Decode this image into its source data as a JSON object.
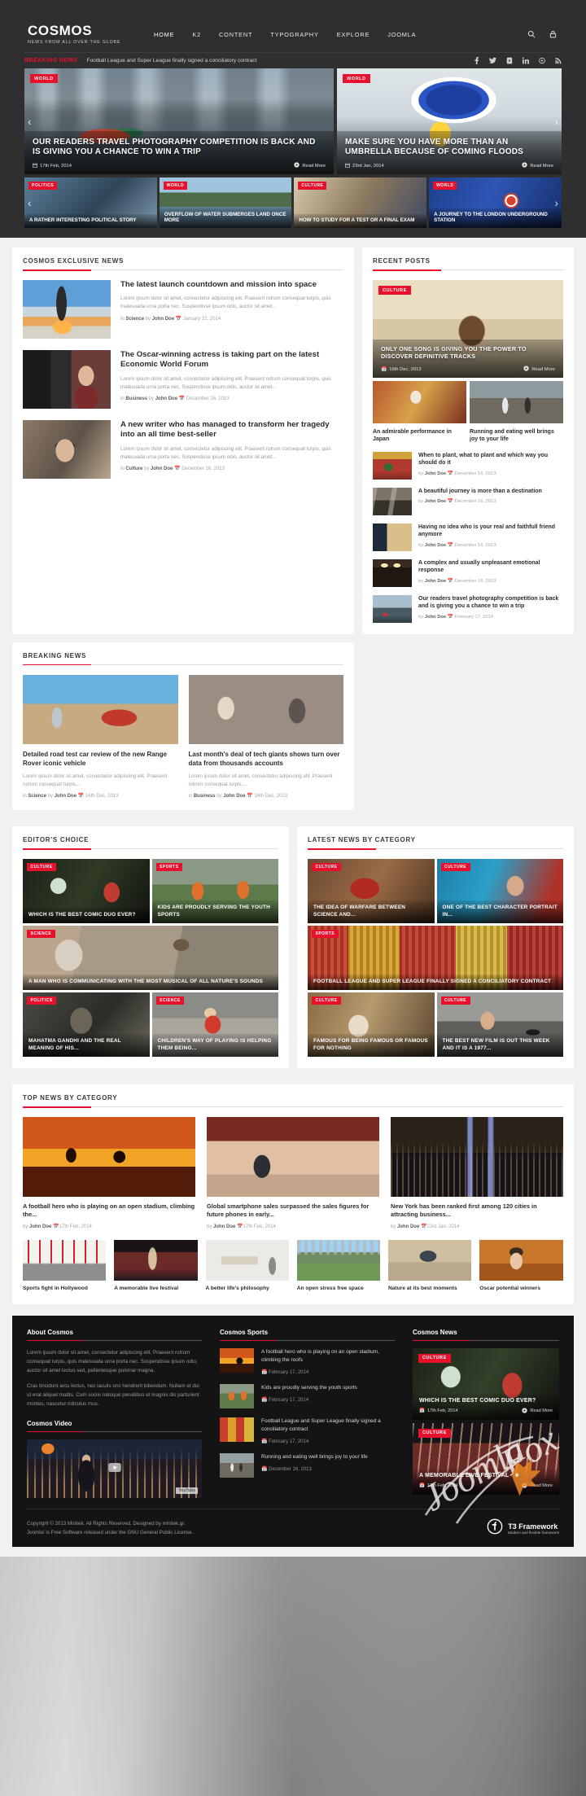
{
  "brand": {
    "name": "COSMOS",
    "tagline": "NEWS FROM ALL OVER THE GLOBE"
  },
  "nav": [
    {
      "label": "HOME"
    },
    {
      "label": "K2"
    },
    {
      "label": "CONTENT"
    },
    {
      "label": "TYPOGRAPHY"
    },
    {
      "label": "EXPLORE"
    },
    {
      "label": "JOOMLA"
    }
  ],
  "header_icons": [
    "search-icon",
    "lock-icon"
  ],
  "breaking_strip": {
    "label": "BREAKING NEWS",
    "text": "Football League and Super League finally signed a conciliatory contract",
    "socials": [
      "facebook-icon",
      "twitter-icon",
      "youtube-icon",
      "linkedin-icon",
      "pinterest-icon",
      "rss-icon"
    ]
  },
  "slider": {
    "prev": "‹",
    "next": "›",
    "slides": [
      {
        "tag": "WORLD",
        "title": "OUR READERS TRAVEL PHOTOGRAPHY COMPETITION IS BACK AND IS GIVING YOU A CHANCE TO WIN A TRIP",
        "date": "17th Feb, 2014",
        "read_more": "Read More"
      },
      {
        "tag": "WORLD",
        "title": "MAKE SURE YOU HAVE MORE THAN AN UMBRELLA BECAUSE OF COMING FLOODS",
        "date": "23rd Jan, 2014",
        "read_more": "Read More"
      }
    ],
    "thumbs": [
      {
        "tag": "POLITICS",
        "title": "A RATHER INTERESTING POLITICAL STORY"
      },
      {
        "tag": "WORLD",
        "title": "OVERFLOW OF WATER SUBMERGES LAND ONCE MORE"
      },
      {
        "tag": "CULTURE",
        "title": "HOW TO STUDY FOR A TEST OR A FINAL EXAM"
      },
      {
        "tag": "WORLD",
        "title": "A JOURNEY TO THE LONDON UNDERGROUND STATION"
      }
    ]
  },
  "exclusive": {
    "title": "COSMOS EXCLUSIVE NEWS",
    "items": [
      {
        "heading": "The latest launch countdown and mission into space",
        "excerpt": "Lorem ipsum dolor sit amet, consectetur adipiscing elit. Praesent rutrum consequat turpis, quis malesuada urna porta nec. Suspendisse ipsum odio, auctor sit amet...",
        "meta_prefix": "in",
        "category": "Science",
        "by": "by",
        "author": "John Doe",
        "date": "January 22, 2014"
      },
      {
        "heading": "The Oscar-winning actress is taking part on the latest Economic World Forum",
        "excerpt": "Lorem ipsum dolor sit amet, consectetur adipiscing elit. Praesent rutrum consequat turpis, quis malesuada urna porta nec. Suspendisse ipsum odio, auctor sit amet...",
        "meta_prefix": "in",
        "category": "Business",
        "by": "by",
        "author": "John Doe",
        "date": "December 16, 2013"
      },
      {
        "heading": "A new writer who has managed to transform her tragedy into an all time best-seller",
        "excerpt": "Lorem ipsum dolor sit amet, consectetur adipiscing elit. Praesent rutrum consequat turpis, quis malesuada urna porta nec. Suspendisse ipsum odio, auctor sit amet...",
        "meta_prefix": "in",
        "category": "Culture",
        "by": "by",
        "author": "John Doe",
        "date": "December 16, 2013"
      }
    ]
  },
  "recent": {
    "title": "RECENT POSTS",
    "hero": {
      "tag": "CULTURE",
      "title": "ONLY ONE SONG IS GIVING YOU THE POWER TO DISCOVER DEFINITIVE TRACKS",
      "date": "16th Dec, 2013",
      "read_more": "Read More"
    },
    "pair": [
      {
        "title": "An admirable performance in Japan"
      },
      {
        "title": "Running and eating well brings joy to your life"
      }
    ],
    "list": [
      {
        "title": "When to plant, what to plant and which way you should do it",
        "by": "by",
        "author": "John Doe",
        "date": "December 16, 2013"
      },
      {
        "title": "A beautiful journey is more than a destination",
        "by": "by",
        "author": "John Doe",
        "date": "December 16, 2013"
      },
      {
        "title": "Having no idea who is your real and faithfull friend anymore",
        "by": "by",
        "author": "John Doe",
        "date": "December 16, 2013"
      },
      {
        "title": "A complex and usually unpleasant emotional response",
        "by": "by",
        "author": "John Doe",
        "date": "December 16, 2013"
      },
      {
        "title": "Our readers travel photography competition is back and is giving you a chance to win a trip",
        "by": "by",
        "author": "John Doe",
        "date": "February 17, 2014"
      }
    ]
  },
  "breaking_module": {
    "title": "BREAKING NEWS",
    "items": [
      {
        "heading": "Detailed road test car review of the new Range Rover iconic vehicle",
        "excerpt": "Lorem ipsum dolor sit amet, consectetur adipiscing elit. Praesent rutrum consequat turpis,...",
        "meta_prefix": "in",
        "category": "Science",
        "by": "by",
        "author": "John Doe",
        "date": "16th Dec, 2013"
      },
      {
        "heading": "Last month's deal of tech giants shows turn over data from thousands accounts",
        "excerpt": "Lorem ipsum dolor sit amet, consectetur adipiscing elit. Praesent rutrum consequat turpis,...",
        "meta_prefix": "in",
        "category": "Business",
        "by": "by",
        "author": "John Doe",
        "date": "16th Dec, 2013"
      }
    ]
  },
  "editors": {
    "title": "EDITOR'S CHOICE",
    "cells": [
      {
        "tag": "CULTURE",
        "title": "WHICH IS THE BEST COMIC DUO EVER?",
        "size": "half"
      },
      {
        "tag": "SPORTS",
        "title": "KIDS ARE PROUDLY SERVING THE YOUTH SPORTS",
        "size": "half"
      },
      {
        "tag": "SCIENCE",
        "title": "A MAN WHO IS COMMUNICATING WITH THE MOST MUSICAL OF ALL NATURE'S SOUNDS",
        "size": "full"
      },
      {
        "tag": "POLITICS",
        "title": "MAHATMA GANDHI AND THE REAL MEANING OF HIS...",
        "size": "half"
      },
      {
        "tag": "SCIENCE",
        "title": "CHILDREN'S WAY OF PLAYING IS HELPING THEM BEING...",
        "size": "half"
      }
    ]
  },
  "latest": {
    "title": "LATEST NEWS BY CATEGORY",
    "cells": [
      {
        "tag": "CULTURE",
        "title": "THE IDEA OF WARFARE BETWEEN SCIENCE AND...",
        "size": "half"
      },
      {
        "tag": "CULTURE",
        "title": "ONE OF THE BEST CHARACTER PORTRAIT IN...",
        "size": "half"
      },
      {
        "tag": "SPORTS",
        "title": "FOOTBALL LEAGUE AND SUPER LEAGUE FINALLY SIGNED A CONCILIATORY CONTRACT",
        "size": "full"
      },
      {
        "tag": "CULTURE",
        "title": "FAMOUS FOR BEING FAMOUS OR FAMOUS FOR NOTHING",
        "size": "half"
      },
      {
        "tag": "CULTURE",
        "title": "THE BEST NEW FILM IS OUT THIS WEEK AND IT IS A 1977...",
        "size": "half"
      }
    ]
  },
  "topnews": {
    "title": "TOP NEWS BY CATEGORY",
    "main": [
      {
        "heading": "A football hero who is playing on an open stadium, climbing the...",
        "by": "by",
        "author": "John Doe",
        "date": "17th Feb, 2014"
      },
      {
        "heading": "Global smartphone sales surpassed the sales figures for future phones in early...",
        "by": "by",
        "author": "John Doe",
        "date": "17th Feb, 2014"
      },
      {
        "heading": "New York has been ranked first among 120 cities in attracting business...",
        "by": "by",
        "author": "John Doe",
        "date": "23rd Jan, 2014"
      }
    ],
    "small": [
      {
        "title": "Sports fight in Hollywood"
      },
      {
        "title": "A memorable live festival"
      },
      {
        "title": "A better life's philosophy"
      },
      {
        "title": "An open stress free space"
      },
      {
        "title": "Nature at its best moments"
      },
      {
        "title": "Oscar potential winners"
      }
    ]
  },
  "footer": {
    "about": {
      "title": "About Cosmos",
      "p1": "Lorem ipsum dolor sit amet, consectetur adipiscing elit. Praesent rutrum consequat turpis, quis malesuada urna porta nec. Suspendisse ipsum odio, auctor sit amet lectus sed, pellentesque pulvinar magna.",
      "p2": "Cras tincidunt arcu lectus, nec iaculis orci hendrerit bibendum. Nullam et dui ut erat aliquet mattis. Cum sociis natoque penatibus et magnis dis parturient montes, nascetur ridiculus mus."
    },
    "video": {
      "title": "Cosmos Video",
      "icon": "youtube-play-icon"
    },
    "sports": {
      "title": "Cosmos Sports",
      "items": [
        {
          "title": "A football hero who is playing on an open stadium, climbing the roofs",
          "date": "February 17, 2014"
        },
        {
          "title": "Kids are proudly serving the youth sports",
          "date": "February 17, 2014"
        },
        {
          "title": "Football League and Super League finally signed a conciliatory contract",
          "date": "February 17, 2014"
        },
        {
          "title": "Running and eating well brings joy to your life",
          "date": "December 16, 2013"
        }
      ]
    },
    "news": {
      "title": "Cosmos News",
      "cards": [
        {
          "tag": "CULTURE",
          "title": "WHICH IS THE BEST COMIC DUO EVER?",
          "date": "17th Feb, 2014",
          "read_more": "Read More"
        },
        {
          "tag": "CULTURE",
          "title": "A MEMORABLE LIVE FESTIVAL",
          "date": "17th Feb, 2014",
          "read_more": "Read More"
        }
      ]
    },
    "copyright_1": "Copyright © 2013 Minitek. All Rights Reserved. Designed by minitek.gr.",
    "copyright_2": "Joomla! is Free Software released under the GNU General Public License.",
    "t3_name": "T3 Framework",
    "t3_sub": "Modern and flexible framework"
  },
  "colors": {
    "accent": "#e8112d",
    "dark": "#2f2f2f",
    "footer": "#141414"
  }
}
